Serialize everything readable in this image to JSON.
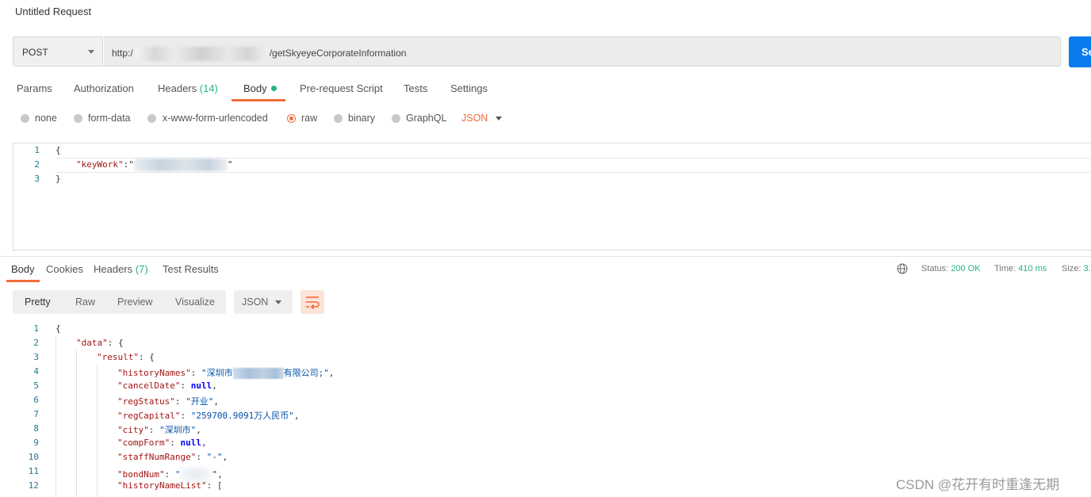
{
  "request": {
    "title": "Untitled Request",
    "method": "POST",
    "url_prefix": "http:/",
    "url_suffix": "/getSkyeyeCorporateInformation",
    "send_label": "Se"
  },
  "request_tabs": [
    {
      "label": "Params"
    },
    {
      "label": "Authorization"
    },
    {
      "label": "Headers",
      "count": "(14)"
    },
    {
      "label": "Body"
    },
    {
      "label": "Pre-request Script"
    },
    {
      "label": "Tests"
    },
    {
      "label": "Settings"
    }
  ],
  "body_options": {
    "none": "none",
    "form_data": "form-data",
    "urlencoded": "x-www-form-urlencoded",
    "raw": "raw",
    "binary": "binary",
    "graphql": "GraphQL",
    "selected_format": "JSON"
  },
  "request_body": {
    "line_numbers": [
      "1",
      "2",
      "3"
    ],
    "open_brace": "{",
    "key": "\"keyWork\"",
    "colon_quote": ":\"",
    "end_quote": "\"",
    "close_brace": "}"
  },
  "response_tabs": [
    {
      "label": "Body"
    },
    {
      "label": "Cookies"
    },
    {
      "label": "Headers",
      "count": "(7)"
    },
    {
      "label": "Test Results"
    }
  ],
  "response_status": {
    "status_label": "Status:",
    "status_value": "200 OK",
    "time_label": "Time:",
    "time_value": "410 ms",
    "size_label": "Size:",
    "size_value": "3."
  },
  "view_modes": {
    "pretty": "Pretty",
    "raw": "Raw",
    "preview": "Preview",
    "visualize": "Visualize",
    "format": "JSON"
  },
  "response_body": {
    "line_numbers": [
      "1",
      "2",
      "3",
      "4",
      "5",
      "6",
      "7",
      "8",
      "9",
      "10",
      "11",
      "12"
    ],
    "l1": "{",
    "l2_key": "\"data\"",
    "l2_rest": ": {",
    "l3_key": "\"result\"",
    "l3_rest": ": {",
    "l4_key": "\"historyNames\"",
    "l4_sep": ": ",
    "l4_val_a": "\"深圳市",
    "l4_val_b": "有限公司;\"",
    "l4_end": ",",
    "l5_key": "\"cancelDate\"",
    "l5_sep": ": ",
    "l5_val": "null",
    "l5_end": ",",
    "l6_key": "\"regStatus\"",
    "l6_sep": ": ",
    "l6_val": "\"开业\"",
    "l6_end": ",",
    "l7_key": "\"regCapital\"",
    "l7_sep": ": ",
    "l7_val": "\"259700.9091万人民币\"",
    "l7_end": ",",
    "l8_key": "\"city\"",
    "l8_sep": ": ",
    "l8_val": "\"深圳市\"",
    "l8_end": ",",
    "l9_key": "\"compForm\"",
    "l9_sep": ": ",
    "l9_val": "null",
    "l9_end": ",",
    "l10_key": "\"staffNumRange\"",
    "l10_sep": ": ",
    "l10_val": "\"-\"",
    "l10_end": ",",
    "l11_key": "\"bondNum\"",
    "l11_sep": ": ",
    "l11_val_a": "\"",
    "l11_end": "\",",
    "l12_key": "\"historyNameList\"",
    "l12_rest": ": ["
  },
  "watermark": "CSDN @花开有时重逢无期"
}
